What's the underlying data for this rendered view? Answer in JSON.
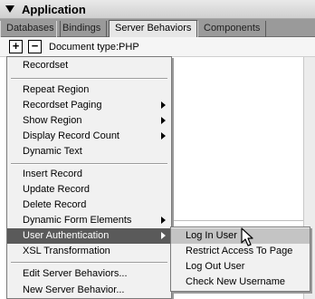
{
  "panel": {
    "title": "Application",
    "tabs": [
      {
        "label": "Databases"
      },
      {
        "label": "Bindings"
      },
      {
        "label": "Server Behaviors",
        "active": true
      },
      {
        "label": "Components"
      }
    ],
    "toolbar": {
      "add_label": "+",
      "remove_label": "−",
      "document_type": "Document type:PHP"
    }
  },
  "menu": {
    "items": [
      {
        "label": "Recordset"
      },
      {
        "label": "Repeat Region"
      },
      {
        "label": "Recordset Paging",
        "submenu": true
      },
      {
        "label": "Show Region",
        "submenu": true
      },
      {
        "label": "Display Record Count",
        "submenu": true
      },
      {
        "label": "Dynamic Text"
      },
      {
        "label": "Insert Record"
      },
      {
        "label": "Update Record"
      },
      {
        "label": "Delete Record"
      },
      {
        "label": "Dynamic Form Elements",
        "submenu": true
      },
      {
        "label": "User Authentication",
        "submenu": true,
        "highlighted": true
      },
      {
        "label": "XSL Transformation"
      },
      {
        "label": "Edit Server Behaviors..."
      },
      {
        "label": "New Server Behavior..."
      }
    ]
  },
  "submenu": {
    "items": [
      {
        "label": "Log In User",
        "hovered": true
      },
      {
        "label": "Restrict Access To Page"
      },
      {
        "label": "Log Out User"
      },
      {
        "label": "Check New Username"
      }
    ]
  },
  "colors": {
    "menu_bg": "#f1f1f1",
    "highlight_bg": "#5a5a5a",
    "hover_bg": "#c4c4c4",
    "tab_strip": "#9a9a9a"
  }
}
